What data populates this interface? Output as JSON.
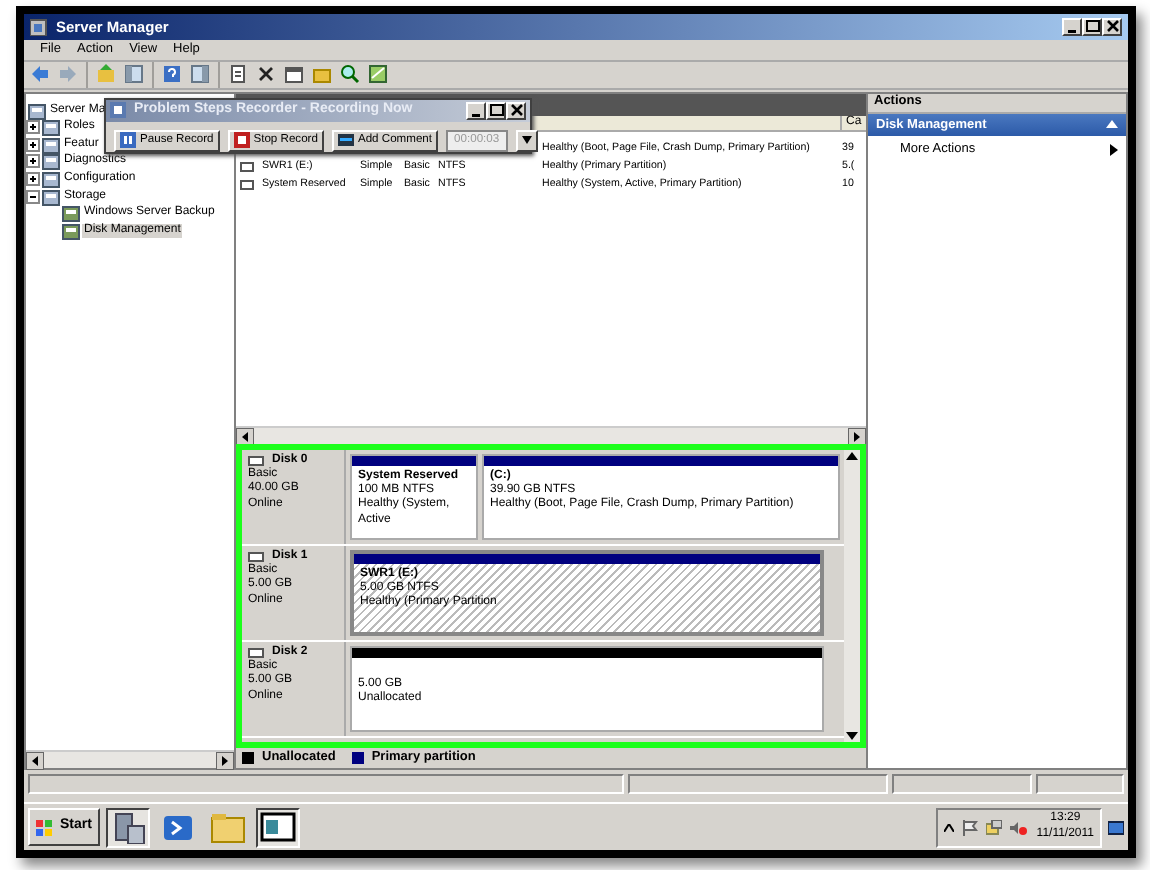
{
  "window": {
    "title": "Server Manager"
  },
  "menu": [
    "File",
    "Action",
    "View",
    "Help"
  ],
  "tree": [
    {
      "label": "Server Ma",
      "selected": false,
      "children": [
        {
          "label": "Roles",
          "expanded": false,
          "selected": false
        },
        {
          "label": "Featur",
          "expanded": false,
          "selected": false
        },
        {
          "label": "Diagnostics",
          "expanded": false,
          "selected": false
        },
        {
          "label": "Configuration",
          "expanded": false,
          "selected": false
        },
        {
          "label": "Storage",
          "expanded": true,
          "selected": false,
          "children": [
            {
              "label": "Windows Server Backup",
              "selected": false
            },
            {
              "label": "Disk Management",
              "selected": true
            }
          ]
        }
      ]
    }
  ],
  "volume_list": {
    "columns": [
      "Ca"
    ],
    "rows": [
      {
        "status": "Healthy (Boot, Page File, Crash Dump, Primary Partition)",
        "capacity": "39"
      },
      {
        "volume": "SWR1 (E:)",
        "layout": "Simple",
        "type": "Basic",
        "file_system": "NTFS",
        "status": "Healthy (Primary Partition)",
        "capacity": "5.("
      },
      {
        "volume": "System Reserved",
        "layout": "Simple",
        "type": "Basic",
        "file_system": "NTFS",
        "status": "Healthy (System, Active, Primary Partition)",
        "capacity": "10"
      }
    ]
  },
  "disks": [
    {
      "name": "Disk 0",
      "type": "Basic",
      "size": "40.00 GB",
      "status": "Online",
      "partitions": [
        {
          "kind": "primary",
          "name": "System Reserved",
          "size": "100 MB NTFS",
          "status": "Healthy (System, Active",
          "selected": false
        },
        {
          "kind": "primary",
          "name": "(C:)",
          "size": "39.90 GB NTFS",
          "status": "Healthy (Boot, Page File, Crash Dump, Primary Partition)",
          "selected": false
        }
      ]
    },
    {
      "name": "Disk 1",
      "type": "Basic",
      "size": "5.00 GB",
      "status": "Online",
      "partitions": [
        {
          "kind": "primary",
          "name": "SWR1  (E:)",
          "size": "5.00 GB NTFS",
          "status": "Healthy (Primary Partition",
          "selected": true
        }
      ]
    },
    {
      "name": "Disk 2",
      "type": "Basic",
      "size": "5.00 GB",
      "status": "Online",
      "partitions": [
        {
          "kind": "unallocated",
          "size": "5.00 GB",
          "status": "Unallocated",
          "selected": false
        }
      ]
    }
  ],
  "legend": [
    {
      "label": "Unallocated",
      "color": "#000000"
    },
    {
      "label": "Primary partition",
      "color": "#00007f"
    }
  ],
  "actions": {
    "title": "Actions",
    "section": "Disk Management",
    "items": [
      "More Actions"
    ]
  },
  "recorder": {
    "title": "Problem Steps Recorder - Recording Now",
    "buttons": [
      {
        "kind": "pause",
        "label": "Pause Record"
      },
      {
        "kind": "stop",
        "label": "Stop Record"
      },
      {
        "kind": "comment",
        "label": "Add Comment"
      }
    ],
    "timer": "00:00:03"
  },
  "taskbar": {
    "start": "Start",
    "time": "13:29",
    "date": "11/11/2011"
  }
}
